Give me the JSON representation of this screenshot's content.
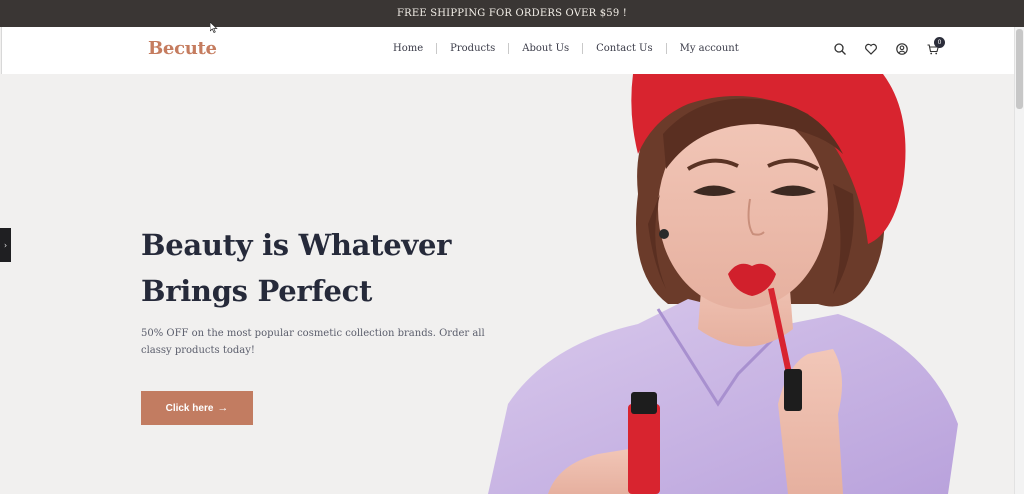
{
  "announcement": "FREE SHIPPING FOR ORDERS OVER $59 !",
  "brand": "Becute",
  "nav": [
    {
      "label": "Home"
    },
    {
      "label": "Products"
    },
    {
      "label": "About Us"
    },
    {
      "label": "Contact Us"
    },
    {
      "label": "My account"
    }
  ],
  "header_icons": [
    "search-icon",
    "heart-icon",
    "user-icon",
    "cart-icon"
  ],
  "cart_count": "0",
  "hero": {
    "headline_line1": "Beauty is Whatever",
    "headline_line2": "Brings Perfect",
    "subtext": "50% OFF on the most popular cosmetic collection brands. Order all classy products today!",
    "cta_label": "Click here",
    "side_tab_icon": "chevron-right-icon"
  },
  "colors": {
    "topbar": "#3a3634",
    "brand": "#c57c5f",
    "cta": "#c27c61",
    "heading": "#262a3a",
    "hero_bg": "#f1f0ef"
  }
}
